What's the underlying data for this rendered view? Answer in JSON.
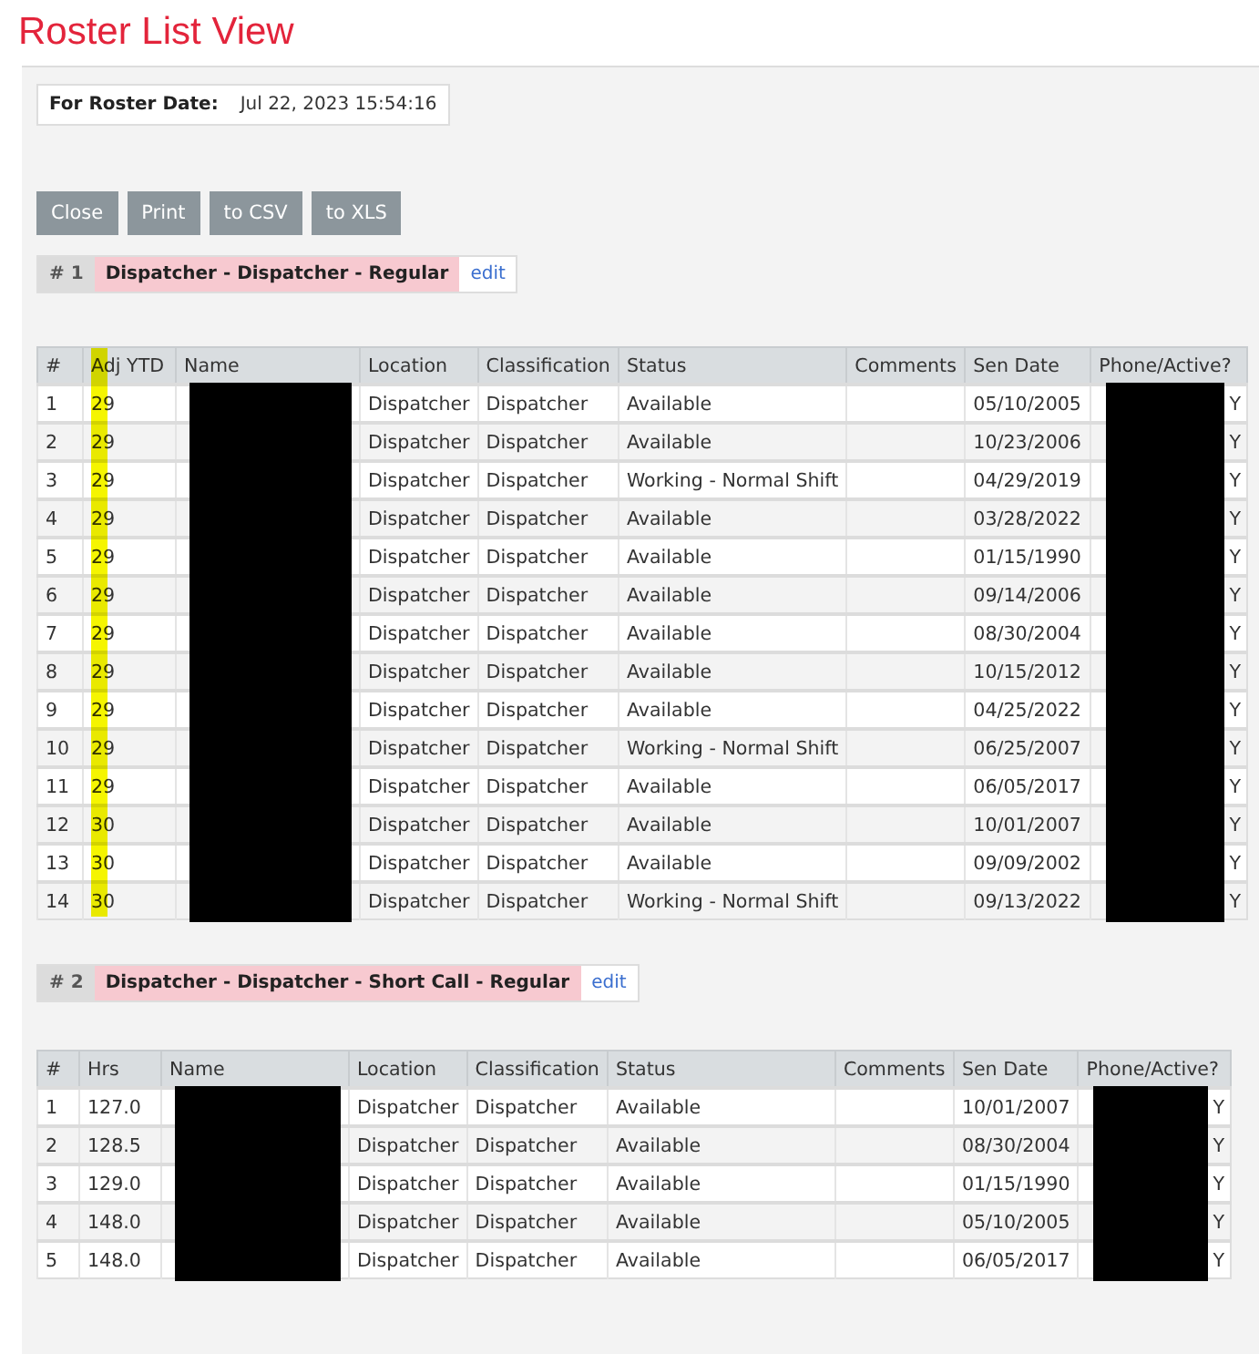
{
  "title": "Roster List View",
  "roster_date": {
    "label": "For Roster Date:",
    "value": "Jul 22, 2023 15:54:16"
  },
  "buttons": [
    "Close",
    "Print",
    "to CSV",
    "to XLS"
  ],
  "sections": [
    {
      "number": "# 1",
      "name": "Dispatcher - Dispatcher - Regular",
      "edit": "edit",
      "columns": [
        {
          "label": "#",
          "kind": "text",
          "highlighted": false
        },
        {
          "label": "Adj YTD",
          "kind": "text",
          "highlighted": true
        },
        {
          "label": "Name",
          "kind": "redacted",
          "highlighted": false
        },
        {
          "label": "Location",
          "kind": "text",
          "highlighted": false
        },
        {
          "label": "Classification",
          "kind": "text",
          "highlighted": false
        },
        {
          "label": "Status",
          "kind": "text",
          "highlighted": false
        },
        {
          "label": "Comments",
          "kind": "text",
          "highlighted": false
        },
        {
          "label": "Sen Date",
          "kind": "text",
          "highlighted": false
        },
        {
          "label": "Phone/Active?",
          "kind": "redacted",
          "highlighted": false
        }
      ],
      "rows": [
        [
          "1",
          "29",
          "",
          "Dispatcher",
          "Dispatcher",
          "Available",
          "",
          "05/10/2005",
          "Y"
        ],
        [
          "2",
          "29",
          "",
          "Dispatcher",
          "Dispatcher",
          "Available",
          "",
          "10/23/2006",
          "Y"
        ],
        [
          "3",
          "29",
          "",
          "Dispatcher",
          "Dispatcher",
          "Working - Normal Shift",
          "",
          "04/29/2019",
          "Y"
        ],
        [
          "4",
          "29",
          "",
          "Dispatcher",
          "Dispatcher",
          "Available",
          "",
          "03/28/2022",
          "Y"
        ],
        [
          "5",
          "29",
          "",
          "Dispatcher",
          "Dispatcher",
          "Available",
          "",
          "01/15/1990",
          "Y"
        ],
        [
          "6",
          "29",
          "",
          "Dispatcher",
          "Dispatcher",
          "Available",
          "",
          "09/14/2006",
          "Y"
        ],
        [
          "7",
          "29",
          "",
          "Dispatcher",
          "Dispatcher",
          "Available",
          "",
          "08/30/2004",
          "Y"
        ],
        [
          "8",
          "29",
          "",
          "Dispatcher",
          "Dispatcher",
          "Available",
          "",
          "10/15/2012",
          "Y"
        ],
        [
          "9",
          "29",
          "",
          "Dispatcher",
          "Dispatcher",
          "Available",
          "",
          "04/25/2022",
          "Y"
        ],
        [
          "10",
          "29",
          "",
          "Dispatcher",
          "Dispatcher",
          "Working - Normal Shift",
          "",
          "06/25/2007",
          "Y"
        ],
        [
          "11",
          "29",
          "",
          "Dispatcher",
          "Dispatcher",
          "Available",
          "",
          "06/05/2017",
          "Y"
        ],
        [
          "12",
          "30",
          "",
          "Dispatcher",
          "Dispatcher",
          "Available",
          "",
          "10/01/2007",
          "Y"
        ],
        [
          "13",
          "30",
          "",
          "Dispatcher",
          "Dispatcher",
          "Available",
          "",
          "09/09/2002",
          "Y"
        ],
        [
          "14",
          "30",
          "",
          "Dispatcher",
          "Dispatcher",
          "Working - Normal Shift",
          "",
          "09/13/2022",
          "Y"
        ]
      ]
    },
    {
      "number": "# 2",
      "name": "Dispatcher - Dispatcher - Short Call - Regular",
      "edit": "edit",
      "columns": [
        {
          "label": "#",
          "kind": "text",
          "highlighted": false
        },
        {
          "label": "Hrs",
          "kind": "text",
          "highlighted": false
        },
        {
          "label": "Name",
          "kind": "redacted",
          "highlighted": false
        },
        {
          "label": "Location",
          "kind": "text",
          "highlighted": false
        },
        {
          "label": "Classification",
          "kind": "text",
          "highlighted": false
        },
        {
          "label": "Status",
          "kind": "text",
          "highlighted": false
        },
        {
          "label": "Comments",
          "kind": "text",
          "highlighted": false
        },
        {
          "label": "Sen Date",
          "kind": "text",
          "highlighted": false
        },
        {
          "label": "Phone/Active?",
          "kind": "redacted",
          "highlighted": false
        }
      ],
      "rows": [
        [
          "1",
          "127.0",
          "",
          "Dispatcher",
          "Dispatcher",
          "Available",
          "",
          "10/01/2007",
          "Y"
        ],
        [
          "2",
          "128.5",
          "",
          "Dispatcher",
          "Dispatcher",
          "Available",
          "",
          "08/30/2004",
          "Y"
        ],
        [
          "3",
          "129.0",
          "",
          "Dispatcher",
          "Dispatcher",
          "Available",
          "",
          "01/15/1990",
          "Y"
        ],
        [
          "4",
          "148.0",
          "",
          "Dispatcher",
          "Dispatcher",
          "Available",
          "",
          "05/10/2005",
          "Y"
        ],
        [
          "5",
          "148.0",
          "",
          "Dispatcher",
          "Dispatcher",
          "Available",
          "",
          "06/05/2017",
          "Y"
        ]
      ]
    }
  ]
}
